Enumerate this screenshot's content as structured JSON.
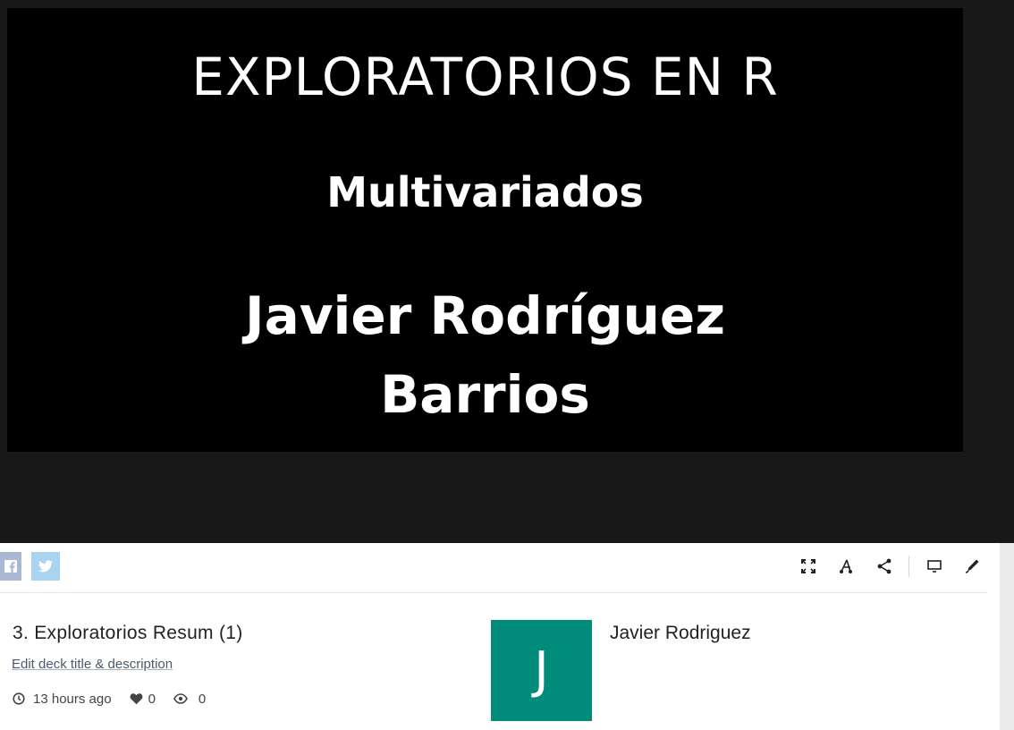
{
  "slide": {
    "title": "EXPLORATORIOS EN R",
    "subtitle": "Multivariados",
    "author": "Javier Rodríguez Barrios"
  },
  "share": {
    "facebook_icon": "facebook-icon",
    "twitter_icon": "twitter-icon"
  },
  "toolbar": {
    "icons": [
      "fullscreen-icon",
      "fork-icon",
      "share-icon",
      "present-icon",
      "edit-icon"
    ]
  },
  "deck": {
    "title": "3. Exploratorios Resum (1)",
    "edit_link": "Edit deck title & description",
    "time_ago": "13 hours ago",
    "likes": "0",
    "views": "0"
  },
  "user": {
    "avatar_letter": "J",
    "name": "Javier Rodriguez"
  },
  "colors": {
    "avatar_bg": "#008b7a",
    "viewer_bg": "#181818",
    "slide_bg": "#000000"
  }
}
